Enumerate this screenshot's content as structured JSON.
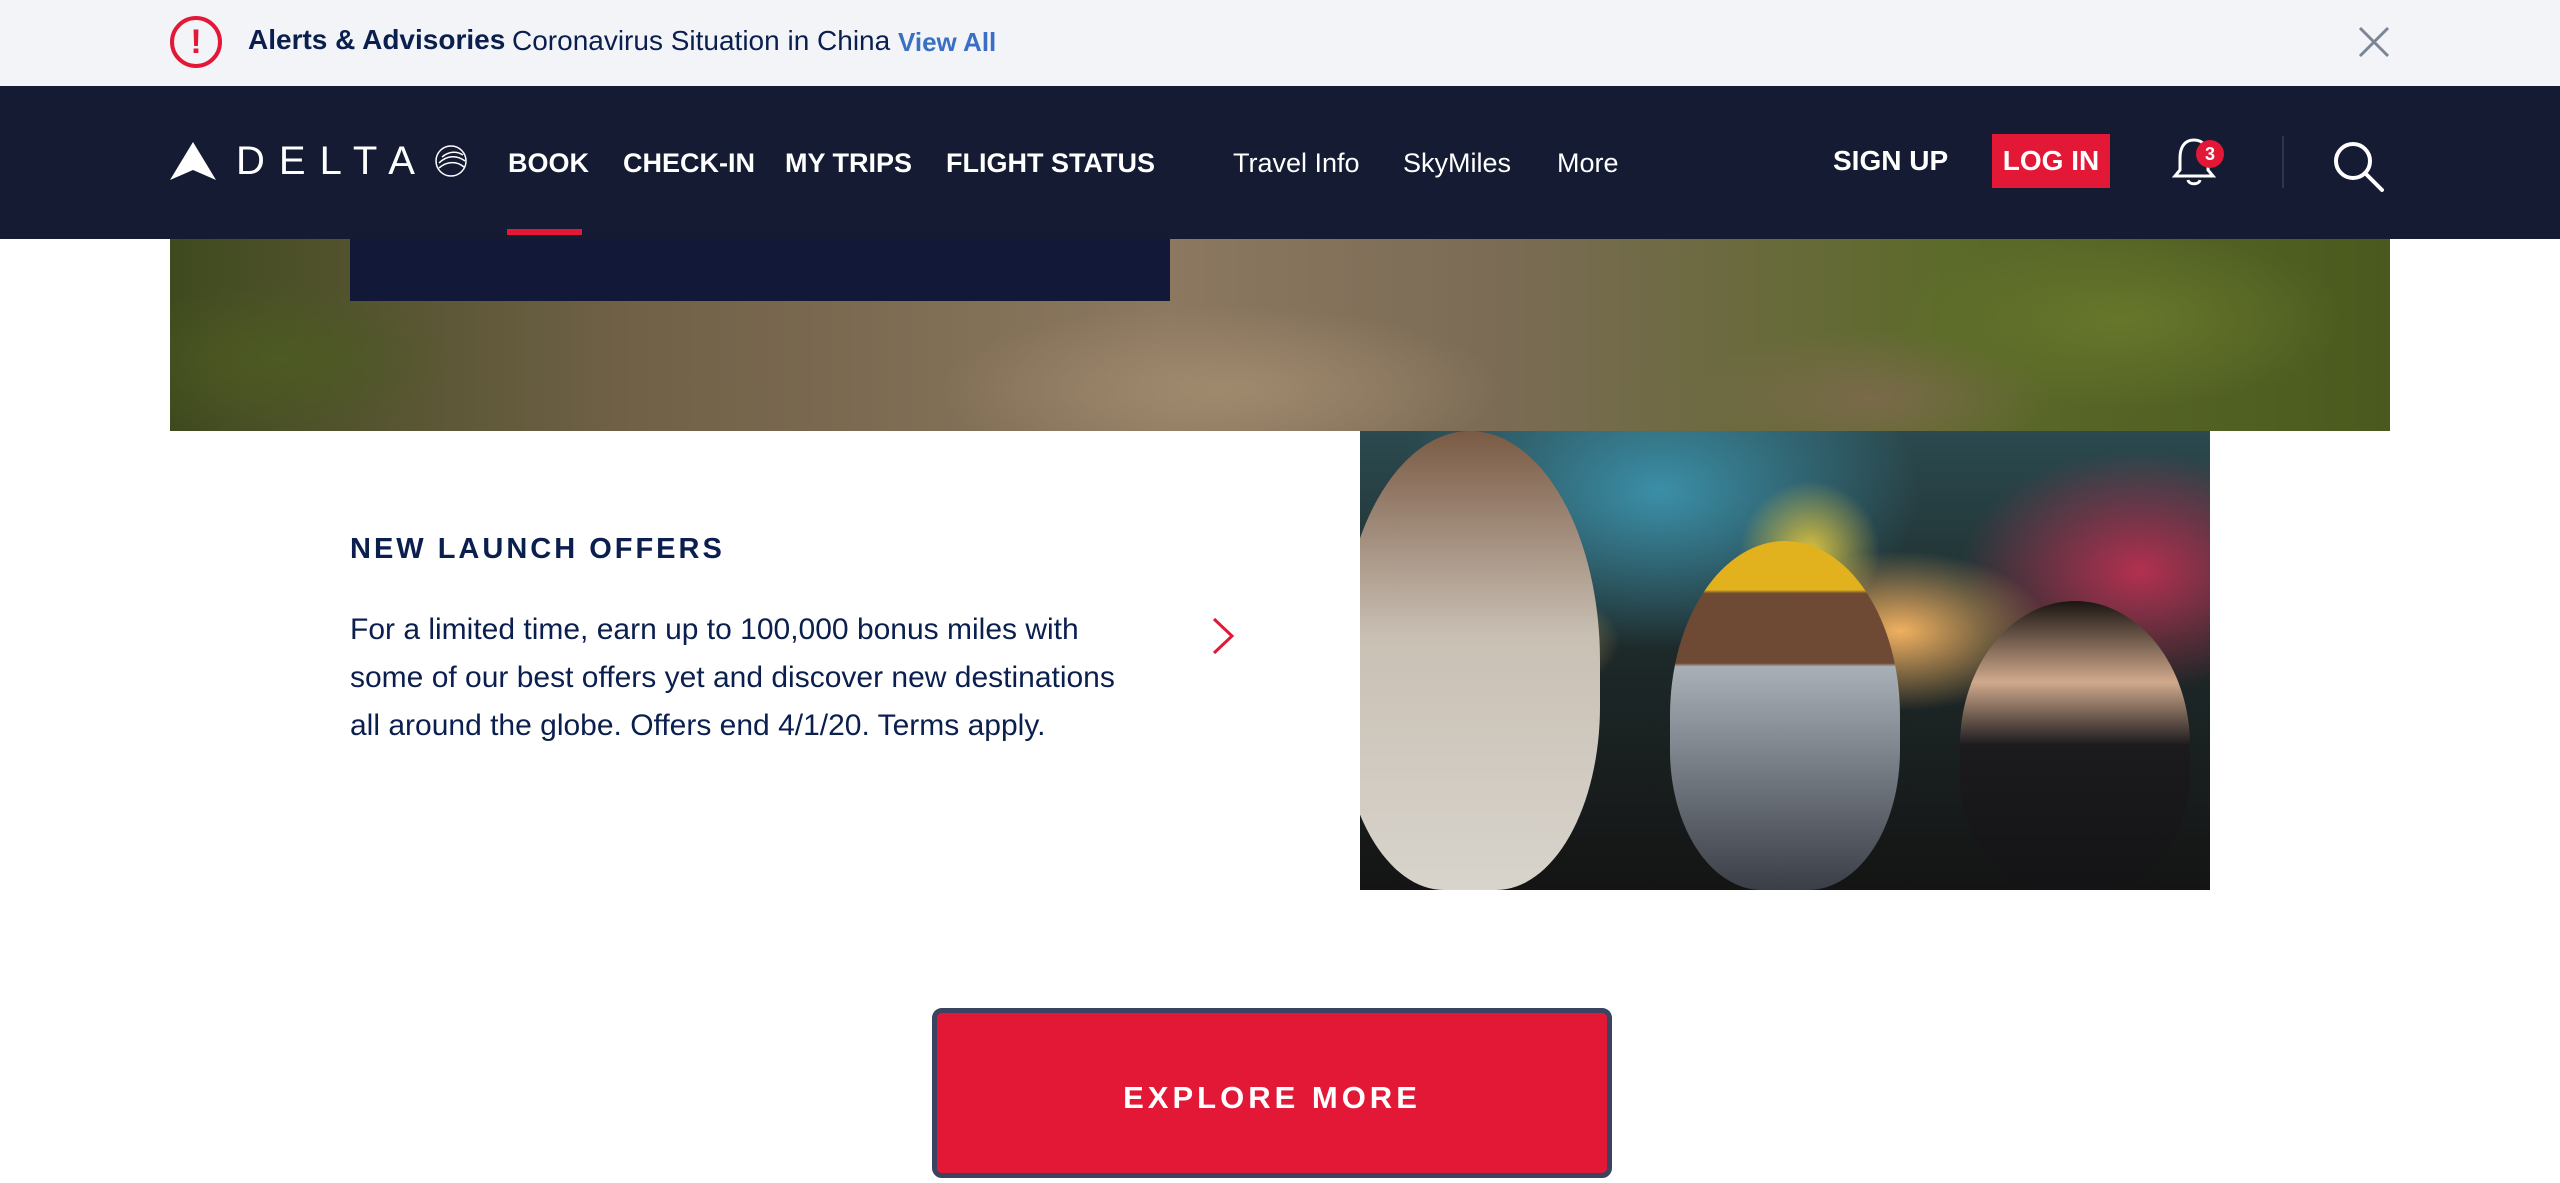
{
  "alert": {
    "icon": "exclamation-circle-icon",
    "title": "Alerts & Advisories",
    "message": "Coronavirus Situation in China",
    "link": "View All"
  },
  "nav": {
    "logo": "DELTA",
    "primary": [
      "BOOK",
      "CHECK-IN",
      "MY TRIPS",
      "FLIGHT STATUS"
    ],
    "active_item": "BOOK",
    "secondary": [
      "Travel Info",
      "SkyMiles",
      "More"
    ],
    "sign_up": "SIGN UP",
    "log_in": "LOG IN",
    "notification_count": "3"
  },
  "offer": {
    "heading": "NEW LAUNCH OFFERS",
    "body": "For a limited time, earn up to 100,000 bonus miles with some of our best offers yet and discover new destinations all around the globe. Offers end 4/1/20. Terms apply."
  },
  "cta": {
    "label": "EXPLORE MORE"
  },
  "colors": {
    "brand_red": "#e31837",
    "nav_bg": "#141b32",
    "text_navy": "#0b1f4f",
    "link_blue": "#3b6fc4"
  }
}
